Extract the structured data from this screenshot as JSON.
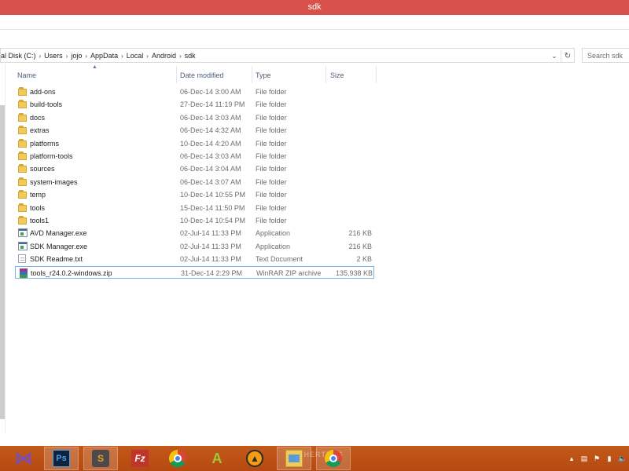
{
  "window": {
    "title": "sdk"
  },
  "address_bar": {
    "crumbs": [
      "al Disk (C:)",
      "Users",
      "jojo",
      "AppData",
      "Local",
      "Android",
      "sdk"
    ],
    "separator": "›",
    "dropdown_icon": "chevron-down-icon",
    "refresh_icon": "refresh-icon"
  },
  "search": {
    "placeholder": "Search sdk"
  },
  "columns": {
    "name": "Name",
    "date": "Date modified",
    "type": "Type",
    "size": "Size"
  },
  "files": [
    {
      "name": "add-ons",
      "date": "06-Dec-14 3:00 AM",
      "type": "File folder",
      "size": "",
      "icon": "folder"
    },
    {
      "name": "build-tools",
      "date": "27-Dec-14 11:19 PM",
      "type": "File folder",
      "size": "",
      "icon": "folder"
    },
    {
      "name": "docs",
      "date": "06-Dec-14 3:03 AM",
      "type": "File folder",
      "size": "",
      "icon": "folder"
    },
    {
      "name": "extras",
      "date": "06-Dec-14 4:32 AM",
      "type": "File folder",
      "size": "",
      "icon": "folder"
    },
    {
      "name": "platforms",
      "date": "10-Dec-14 4:20 AM",
      "type": "File folder",
      "size": "",
      "icon": "folder"
    },
    {
      "name": "platform-tools",
      "date": "06-Dec-14 3:03 AM",
      "type": "File folder",
      "size": "",
      "icon": "folder"
    },
    {
      "name": "sources",
      "date": "06-Dec-14 3:04 AM",
      "type": "File folder",
      "size": "",
      "icon": "folder"
    },
    {
      "name": "system-images",
      "date": "06-Dec-14 3:07 AM",
      "type": "File folder",
      "size": "",
      "icon": "folder"
    },
    {
      "name": "temp",
      "date": "10-Dec-14 10:55 PM",
      "type": "File folder",
      "size": "",
      "icon": "folder"
    },
    {
      "name": "tools",
      "date": "15-Dec-14 11:50 PM",
      "type": "File folder",
      "size": "",
      "icon": "folder"
    },
    {
      "name": "tools1",
      "date": "10-Dec-14 10:54 PM",
      "type": "File folder",
      "size": "",
      "icon": "folder"
    },
    {
      "name": "AVD Manager.exe",
      "date": "02-Jul-14 11:33 PM",
      "type": "Application",
      "size": "216 KB",
      "icon": "exe"
    },
    {
      "name": "SDK Manager.exe",
      "date": "02-Jul-14 11:33 PM",
      "type": "Application",
      "size": "216 KB",
      "icon": "exe"
    },
    {
      "name": "SDK Readme.txt",
      "date": "02-Jul-14 11:33 PM",
      "type": "Text Document",
      "size": "2 KB",
      "icon": "txt"
    },
    {
      "name": "tools_r24.0.2-windows.zip",
      "date": "31-Dec-14 2:29 PM",
      "type": "WinRAR ZIP archive",
      "size": "135,938 KB",
      "icon": "zip",
      "selected": true
    }
  ],
  "taskbar": {
    "apps": [
      {
        "name": "visual-studio-icon",
        "glyph": "⋈"
      },
      {
        "name": "photoshop-icon",
        "glyph": "Ps",
        "active": true
      },
      {
        "name": "sublime-text-icon",
        "glyph": "S",
        "active": true
      },
      {
        "name": "filezilla-icon",
        "glyph": "Fz"
      },
      {
        "name": "chrome-icon",
        "glyph": ""
      },
      {
        "name": "android-studio-icon",
        "glyph": "A"
      },
      {
        "name": "vlc-icon",
        "glyph": "▲"
      },
      {
        "name": "file-explorer-icon",
        "glyph": "",
        "active": true
      },
      {
        "name": "chrome-icon",
        "glyph": "",
        "active": true
      }
    ],
    "wallpaper_text": "THERTRES",
    "tray_icons": [
      "show-hidden-icons-icon",
      "network-icon",
      "flag-icon",
      "battery-icon",
      "volume-icon"
    ]
  },
  "colors": {
    "title_bar": "#d8514a",
    "taskbar": "#b54a10",
    "selection_border": "#7ab5e9",
    "header_text": "#4c607a"
  }
}
